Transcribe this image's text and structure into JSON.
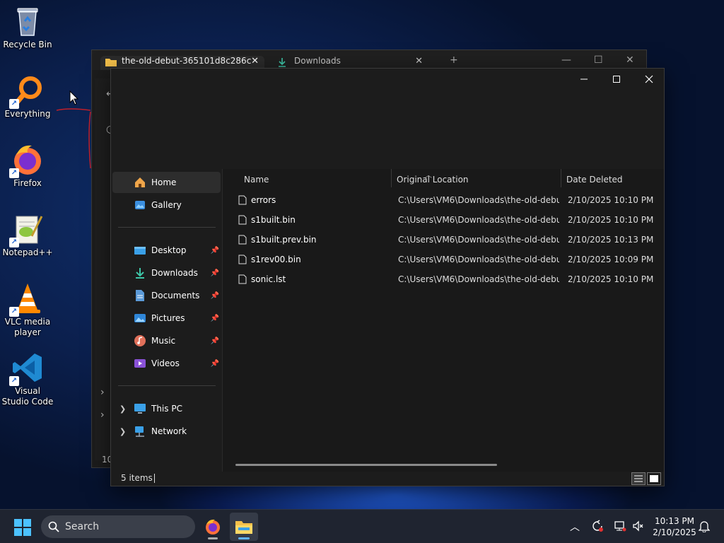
{
  "desktop": {
    "icons": [
      {
        "label": "Recycle Bin",
        "icon": "recycle-bin-icon"
      },
      {
        "label": "Everything",
        "icon": "everything-search-icon"
      },
      {
        "label": "Firefox",
        "icon": "firefox-icon"
      },
      {
        "label": "Notepad++",
        "icon": "notepad-plus-plus-icon"
      },
      {
        "label": "VLC media player",
        "icon": "vlc-cone-icon"
      },
      {
        "label": "Visual Studio Code",
        "icon": "vscode-icon"
      }
    ]
  },
  "background_window": {
    "tabs": [
      {
        "label": "the-old-debut-365101d8c286c",
        "icon": "folder-icon"
      },
      {
        "label": "Downloads",
        "icon": "download-icon"
      }
    ],
    "new_tab": "+",
    "status_fragment": "10"
  },
  "window": {
    "nav": {
      "home": "Home",
      "gallery": "Gallery",
      "quick_access": [
        {
          "label": "Desktop",
          "icon": "desktop-folder-icon",
          "pinned": true
        },
        {
          "label": "Downloads",
          "icon": "downloads-folder-icon",
          "pinned": true
        },
        {
          "label": "Documents",
          "icon": "documents-folder-icon",
          "pinned": true
        },
        {
          "label": "Pictures",
          "icon": "pictures-folder-icon",
          "pinned": true
        },
        {
          "label": "Music",
          "icon": "music-folder-icon",
          "pinned": true
        },
        {
          "label": "Videos",
          "icon": "videos-folder-icon",
          "pinned": true
        }
      ],
      "this_pc": "This PC",
      "network": "Network"
    },
    "columns": {
      "name": "Name",
      "original_location": "Original Location",
      "date_deleted": "Date Deleted"
    },
    "files": [
      {
        "name": "errors",
        "location": "C:\\Users\\VM6\\Downloads\\the-old-debut...",
        "date": "2/10/2025 10:10 PM"
      },
      {
        "name": "s1built.bin",
        "location": "C:\\Users\\VM6\\Downloads\\the-old-debut...",
        "date": "2/10/2025 10:10 PM"
      },
      {
        "name": "s1built.prev.bin",
        "location": "C:\\Users\\VM6\\Downloads\\the-old-debut...",
        "date": "2/10/2025 10:13 PM"
      },
      {
        "name": "s1rev00.bin",
        "location": "C:\\Users\\VM6\\Downloads\\the-old-debut...",
        "date": "2/10/2025 10:09 PM"
      },
      {
        "name": "sonic.lst",
        "location": "C:\\Users\\VM6\\Downloads\\the-old-debut...",
        "date": "2/10/2025 10:10 PM"
      }
    ],
    "status": "5 items"
  },
  "taskbar": {
    "search_placeholder": "Search",
    "time": "10:13 PM",
    "date": "2/10/2025"
  },
  "colors": {
    "accent": "#5fb2ff",
    "window_bg": "#191919",
    "taskbar_bg": "#1f2430"
  }
}
